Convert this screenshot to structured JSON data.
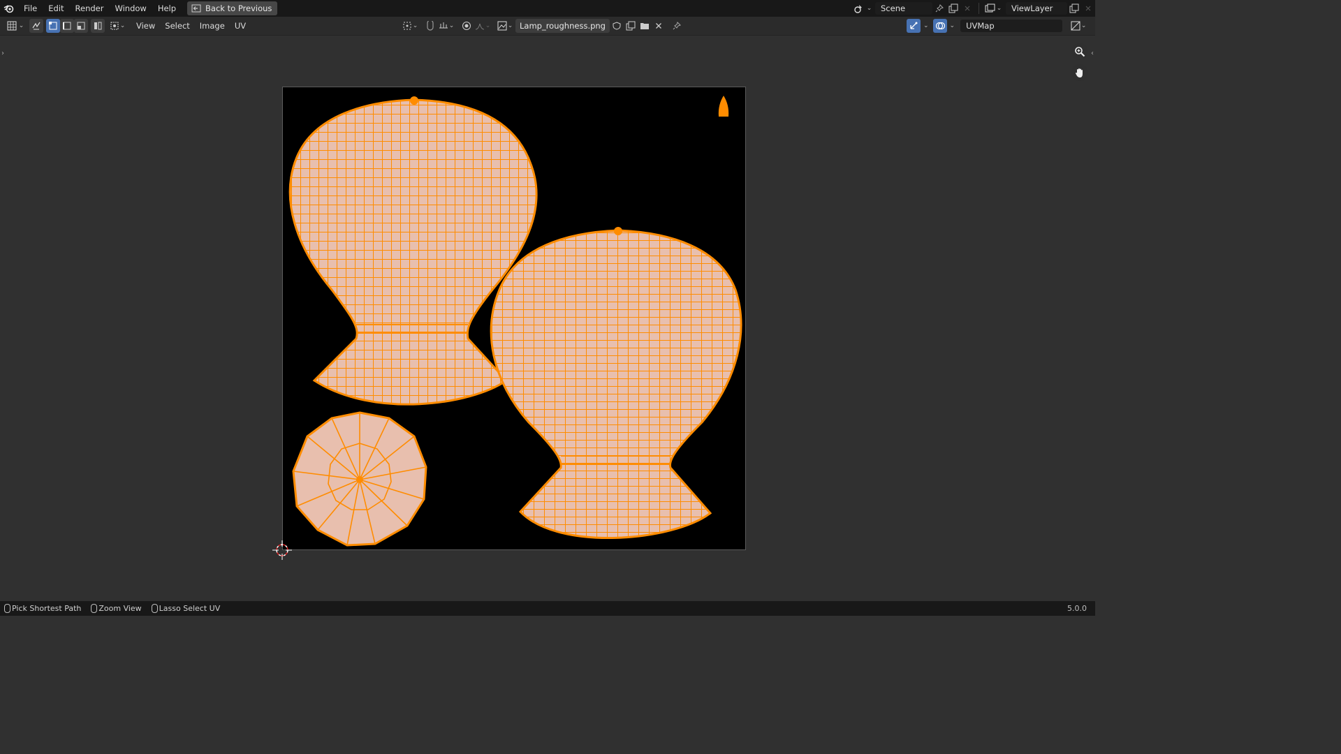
{
  "topbar": {
    "menus": [
      "File",
      "Edit",
      "Render",
      "Window",
      "Help"
    ],
    "back_label": "Back to Previous",
    "scene_name": "Scene",
    "view_layer": "ViewLayer"
  },
  "header": {
    "menus": [
      "View",
      "Select",
      "Image",
      "UV"
    ],
    "image_name": "Lamp_roughness.png",
    "uv_map": "UVMap"
  },
  "status": {
    "hints": [
      "Pick Shortest Path",
      "Zoom View",
      "Lasso Select UV"
    ],
    "version": "5.0.0"
  },
  "colors": {
    "accent": "#4772b3",
    "uv_face": "#e8bfae",
    "uv_edge": "#ff8c00",
    "background": "#303030"
  }
}
